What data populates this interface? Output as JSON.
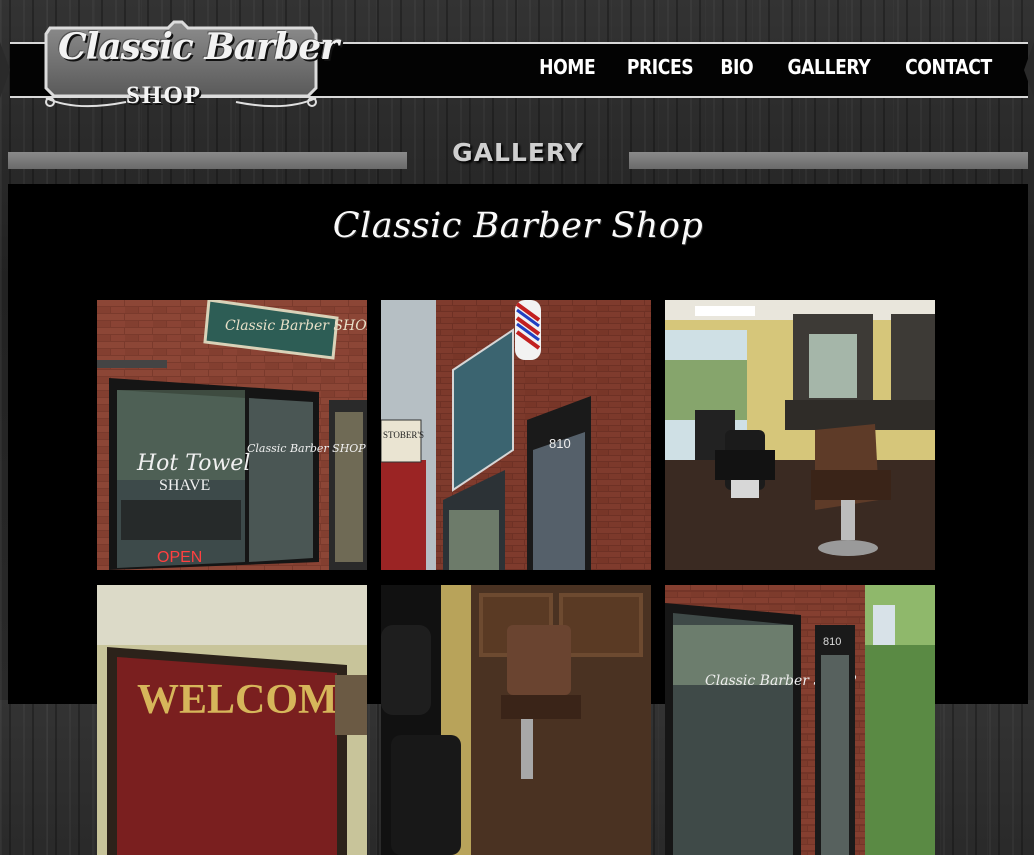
{
  "logo": {
    "line1": "Classic Barber",
    "line2": "SHOP"
  },
  "nav": {
    "items": [
      {
        "label": "HOME"
      },
      {
        "label": "PRICES"
      },
      {
        "label": "BIO"
      },
      {
        "label": "GALLERY"
      },
      {
        "label": "CONTACT"
      }
    ]
  },
  "section": {
    "title": "GALLERY"
  },
  "content": {
    "heading": "Classic Barber Shop",
    "gallery": [
      {
        "photo": "storefront-window-hot-towel-shave",
        "sign": "Classic Barber SHOP",
        "window_text_1": "Hot Towel",
        "window_text_2": "SHAVE",
        "window_text_3": "Classic Barber SHOP",
        "neon": "OPEN"
      },
      {
        "photo": "storefront-corner-barber-pole",
        "door_number": "810",
        "side_sign": "STOBER'S"
      },
      {
        "photo": "interior-barber-chairs"
      },
      {
        "photo": "interior-welcome-sign",
        "sign_text": "WELCOME"
      },
      {
        "photo": "interior-chair-closeup"
      },
      {
        "photo": "storefront-window-side",
        "door_number": "810",
        "window_text": "Classic Barber SHOP"
      }
    ]
  },
  "colors": {
    "background": "#222222",
    "header_band": "#030303",
    "panel": "#000000",
    "text": "#ffffff",
    "title_bar": "#777777"
  }
}
